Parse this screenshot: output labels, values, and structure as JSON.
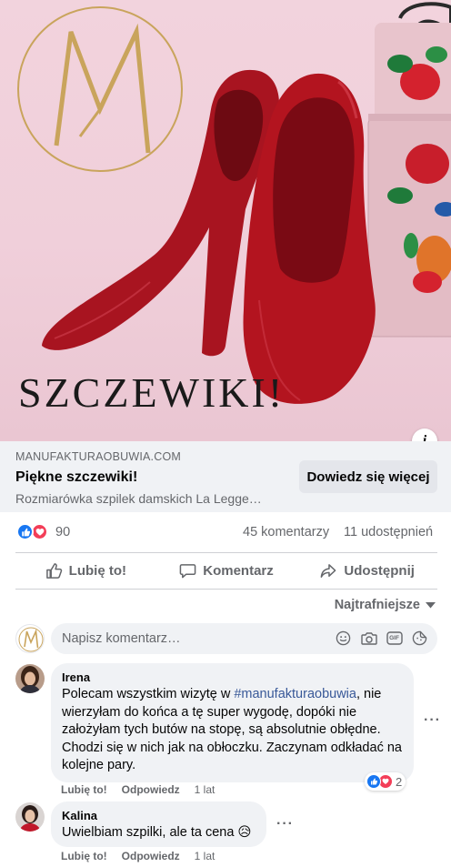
{
  "ad": {
    "headline": "SZCZEWIKI!",
    "domain": "MANUFAKTURAOBUWIA.COM",
    "title": "Piękne szczewiki!",
    "description": "Rozmiarówka szpilek damskich La Legge…",
    "cta_label": "Dowiedz się więcej",
    "info_icon": "i"
  },
  "stats": {
    "reactions_count": "90",
    "comments_label": "45 komentarzy",
    "shares_label": "11 udostępnień"
  },
  "actions": {
    "like_label": "Lubię to!",
    "comment_label": "Komentarz",
    "share_label": "Udostępnij"
  },
  "sort_label": "Najtrafniejsze",
  "composer": {
    "placeholder": "Napisz komentarz…",
    "icons": [
      "emoji-icon",
      "camera-icon",
      "gif-icon",
      "sticker-icon"
    ],
    "gif_text": "GIF"
  },
  "comments": [
    {
      "author": "Irena",
      "text_before": "Polecam wszystkim wizytę w ",
      "hashtag": "#manufakturaobuwia",
      "text_after": ", nie wierzyłam do końca a tę super wygodę, dopóki nie założyłam tych butów na stopę, są absolutnie obłędne. Chodzi się w nich jak na obłoczku. Zaczynam odkładać na kolejne pary.",
      "like_label": "Lubię to!",
      "reply_label": "Odpowiedz",
      "time": "1 lat",
      "reaction_count": "2"
    },
    {
      "author": "Kalina",
      "text": "Uwielbiam szpilki, ale ta cena 😥",
      "like_label": "Lubię to!",
      "reply_label": "Odpowiedz",
      "time": "1 lat"
    }
  ],
  "colors": {
    "facebook_blue": "#1877f2",
    "love_red": "#f33e58",
    "secondary_text": "#65676b",
    "bubble_bg": "#f0f2f5",
    "hashtag": "#385898",
    "shoe_red": "#b3141f",
    "background_pink": "#f0cfda",
    "logo_gold": "#c9a45c"
  }
}
